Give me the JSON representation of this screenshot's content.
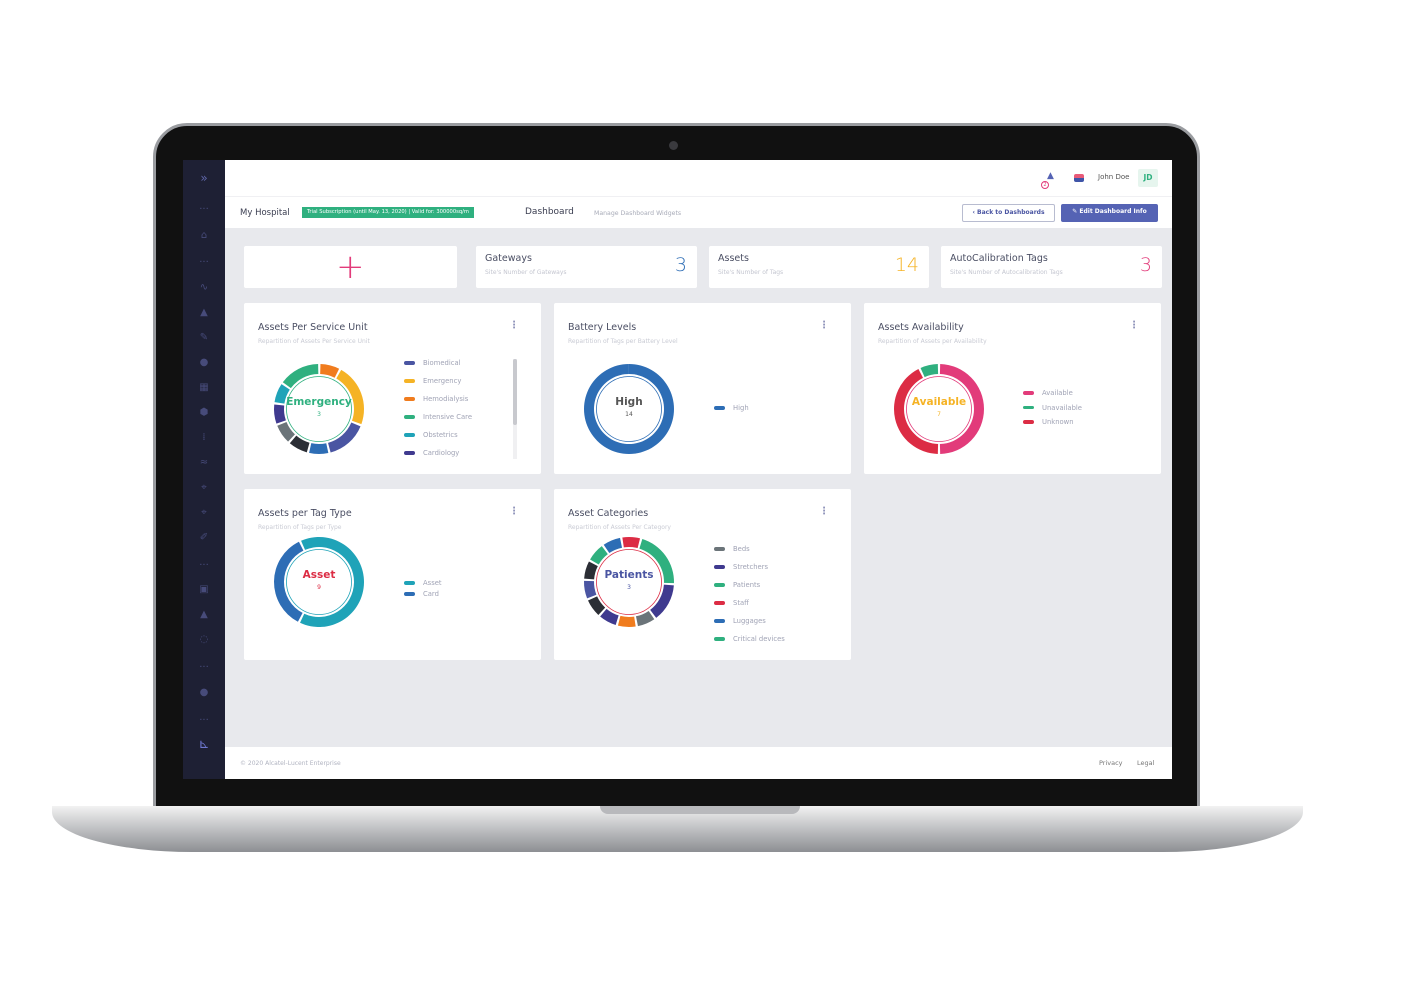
{
  "header": {
    "notification_count": "2",
    "user_name": "John Doe",
    "user_initials": "JD"
  },
  "subheader": {
    "site": "My Hospital",
    "subscription_badge": "Trial Subscription (until May. 13, 2020)  |  Valid for: 300000sq/m",
    "page": "Dashboard",
    "page_sub": "Manage Dashboard Widgets",
    "back_label": "Back to Dashboards",
    "edit_label": "Edit Dashboard Info",
    "accent": "#5563b4",
    "badge_color": "#2fb07f"
  },
  "kpis": [
    {
      "title": "Gateways",
      "subtitle": "Site's Number of Gateways",
      "value": "3",
      "color": "#2d6db5"
    },
    {
      "title": "Assets",
      "subtitle": "Site's Number of Tags",
      "value": "14",
      "color": "#f5b325"
    },
    {
      "title": "AutoCalibration Tags",
      "subtitle": "Site's Number of Autocalibration Tags",
      "value": "3",
      "color": "#e23b7a"
    }
  ],
  "widgets": [
    {
      "title": "Assets Per Service Unit",
      "subtitle": "Repartition of Assets Per Service Unit",
      "center_label": "Emergency",
      "center_value": "3",
      "center_color": "#2fb07f",
      "legend": [
        {
          "label": "Biomedical",
          "color": "#4a55a2"
        },
        {
          "label": "Emergency",
          "color": "#f5b325"
        },
        {
          "label": "Hemodialysis",
          "color": "#f07c1e"
        },
        {
          "label": "Intensive Care",
          "color": "#2fb07f"
        },
        {
          "label": "Obstetrics",
          "color": "#1fa3b8"
        },
        {
          "label": "Cardiology",
          "color": "#3f3a8f"
        }
      ],
      "segments": [
        {
          "value": 2,
          "color": "#2fb07f"
        },
        {
          "value": 1,
          "color": "#f07c1e"
        },
        {
          "value": 3,
          "color": "#f5b325"
        },
        {
          "value": 2,
          "color": "#4a55a2"
        },
        {
          "value": 1,
          "color": "#2d6db5"
        },
        {
          "value": 1,
          "color": "#2b2e35"
        },
        {
          "value": 1,
          "color": "#6b7479"
        },
        {
          "value": 1,
          "color": "#3f3a8f"
        },
        {
          "value": 1,
          "color": "#1fa3b8"
        }
      ]
    },
    {
      "title": "Battery Levels",
      "subtitle": "Repartition of Tags per Battery Level",
      "center_label": "High",
      "center_value": "14",
      "center_color": "#555",
      "legend": [
        {
          "label": "High",
          "color": "#2d6db5"
        }
      ],
      "segments": [
        {
          "value": 14,
          "color": "#2d6db5"
        }
      ]
    },
    {
      "title": "Assets Availability",
      "subtitle": "Repartition of Assets per Availability",
      "center_label": "Available",
      "center_value": "7",
      "center_color": "#f5b325",
      "legend": [
        {
          "label": "Available",
          "color": "#e23b7a"
        },
        {
          "label": "Unavailable",
          "color": "#2fb07f"
        },
        {
          "label": "Unknown",
          "color": "#dc2c44"
        }
      ],
      "segments": [
        {
          "value": 7,
          "color": "#e23b7a"
        },
        {
          "value": 6,
          "color": "#dc2c44"
        },
        {
          "value": 1,
          "color": "#2fb07f"
        }
      ]
    },
    {
      "title": "Assets per Tag Type",
      "subtitle": "Repartition of Tags per Type",
      "center_label": "Asset",
      "center_value": "9",
      "center_color": "#dc2c44",
      "legend": [
        {
          "label": "Asset",
          "color": "#1fa3b8"
        },
        {
          "label": "Card",
          "color": "#2d6db5"
        }
      ],
      "segments": [
        {
          "value": 9,
          "color": "#1fa3b8"
        },
        {
          "value": 5,
          "color": "#2d6db5"
        }
      ]
    },
    {
      "title": "Asset Categories",
      "subtitle": "Repartition of Assets Per Category",
      "center_label": "Patients",
      "center_value": "3",
      "center_color": "#4a55a2",
      "legend": [
        {
          "label": "Beds",
          "color": "#6b7479"
        },
        {
          "label": "Stretchers",
          "color": "#3f3a8f"
        },
        {
          "label": "Patients",
          "color": "#2fb07f"
        },
        {
          "label": "Staff",
          "color": "#dc2c44"
        },
        {
          "label": "Luggages",
          "color": "#2d6db5"
        },
        {
          "label": "Critical devices",
          "color": "#2fb07f"
        }
      ],
      "segments": [
        {
          "value": 1,
          "color": "#dc2c44"
        },
        {
          "value": 3,
          "color": "#2fb07f"
        },
        {
          "value": 2,
          "color": "#3f3a8f"
        },
        {
          "value": 1,
          "color": "#6b7479"
        },
        {
          "value": 1,
          "color": "#f07c1e"
        },
        {
          "value": 1,
          "color": "#3f3a8f"
        },
        {
          "value": 1,
          "color": "#2b2e35"
        },
        {
          "value": 1,
          "color": "#4a55a2"
        },
        {
          "value": 1,
          "color": "#2b2e35"
        },
        {
          "value": 1,
          "color": "#2fb07f"
        },
        {
          "value": 1,
          "color": "#2d6db5"
        }
      ]
    }
  ],
  "footer": {
    "copyright": "© 2020 Alcatel-Lucent Enterprise",
    "privacy": "Privacy",
    "legal": "Legal"
  }
}
